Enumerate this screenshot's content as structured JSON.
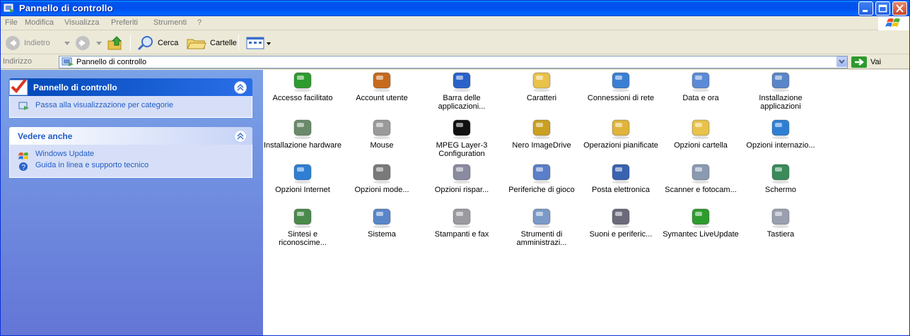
{
  "window": {
    "title": "Pannello di controllo"
  },
  "menu": [
    "File",
    "Modifica",
    "Visualizza",
    "Preferiti",
    "Strumenti",
    "?"
  ],
  "toolbar": {
    "back": "Indietro",
    "search": "Cerca",
    "folders": "Cartelle"
  },
  "address": {
    "label": "Indirizzo",
    "value": "Pannello di controllo",
    "go": "Vai"
  },
  "taskpane": {
    "panel1": {
      "title": "Pannello di controllo",
      "link": "Passa alla visualizzazione per categorie"
    },
    "panel2": {
      "title": "Vedere anche",
      "links": [
        "Windows Update",
        "Guida in linea e supporto tecnico"
      ]
    }
  },
  "items": [
    {
      "label": "Accesso facilitato",
      "icon": "accessibility-icon",
      "color": "#2e9b2e"
    },
    {
      "label": "Account utente",
      "icon": "user-accounts-icon",
      "color": "#c66a1e"
    },
    {
      "label": "Barra delle applicazioni...",
      "icon": "taskbar-icon",
      "color": "#2a62c9"
    },
    {
      "label": "Caratteri",
      "icon": "fonts-folder-icon",
      "color": "#e8c24a"
    },
    {
      "label": "Connessioni di rete",
      "icon": "network-icon",
      "color": "#3b7fd4"
    },
    {
      "label": "Data e ora",
      "icon": "clock-icon",
      "color": "#5b8bd6"
    },
    {
      "label": "Installazione applicazioni",
      "icon": "add-remove-icon",
      "color": "#5a86c8"
    },
    {
      "label": "Installazione hardware",
      "icon": "hardware-icon",
      "color": "#6a8a6a"
    },
    {
      "label": "Mouse",
      "icon": "mouse-icon",
      "color": "#9a9a9a"
    },
    {
      "label": "MPEG Layer-3 Configuration",
      "icon": "mp3-icon",
      "color": "#111111"
    },
    {
      "label": "Nero ImageDrive",
      "icon": "nero-icon",
      "color": "#c9a020"
    },
    {
      "label": "Operazioni pianificate",
      "icon": "scheduled-tasks-icon",
      "color": "#e0b43c"
    },
    {
      "label": "Opzioni cartella",
      "icon": "folder-options-icon",
      "color": "#e8c24a"
    },
    {
      "label": "Opzioni internazio...",
      "icon": "globe-icon",
      "color": "#2e7fd4"
    },
    {
      "label": "Opzioni Internet",
      "icon": "internet-icon",
      "color": "#2e7fd4"
    },
    {
      "label": "Opzioni mode...",
      "icon": "modem-icon",
      "color": "#7a7a7a"
    },
    {
      "label": "Opzioni rispar...",
      "icon": "power-icon",
      "color": "#8a8aa0"
    },
    {
      "label": "Periferiche di gioco",
      "icon": "gamepad-icon",
      "color": "#5a7fc8"
    },
    {
      "label": "Posta elettronica",
      "icon": "mail-icon",
      "color": "#3a62b0"
    },
    {
      "label": "Scanner e fotocam...",
      "icon": "scanner-icon",
      "color": "#8a9ab0"
    },
    {
      "label": "Schermo",
      "icon": "display-icon",
      "color": "#3a8a5a"
    },
    {
      "label": "Sintesi e riconoscime...",
      "icon": "speech-icon",
      "color": "#4a8a4a"
    },
    {
      "label": "Sistema",
      "icon": "system-icon",
      "color": "#5a86c8"
    },
    {
      "label": "Stampanti e fax",
      "icon": "printer-icon",
      "color": "#9a9aa0"
    },
    {
      "label": "Strumenti di amministrazi...",
      "icon": "admin-tools-icon",
      "color": "#7a9ac8"
    },
    {
      "label": "Suoni e periferic...",
      "icon": "speaker-icon",
      "color": "#6a6a7a"
    },
    {
      "label": "Symantec LiveUpdate",
      "icon": "liveupdate-icon",
      "color": "#2e9b2e"
    },
    {
      "label": "Tastiera",
      "icon": "keyboard-icon",
      "color": "#9aa0b0"
    }
  ]
}
